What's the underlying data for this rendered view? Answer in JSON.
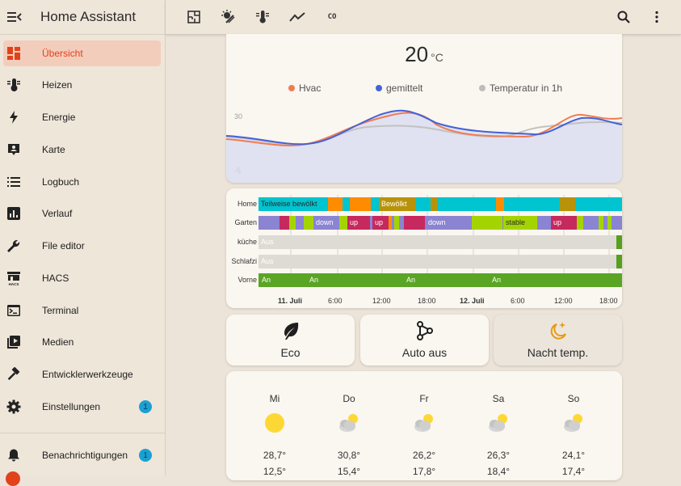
{
  "app": {
    "title": "Home Assistant"
  },
  "sidebar": {
    "items": [
      {
        "label": "Übersicht",
        "icon": "dashboard-icon",
        "active": true
      },
      {
        "label": "Heizen",
        "icon": "thermometer-icon"
      },
      {
        "label": "Energie",
        "icon": "lightning-icon"
      },
      {
        "label": "Karte",
        "icon": "map-account-icon"
      },
      {
        "label": "Logbuch",
        "icon": "list-icon"
      },
      {
        "label": "Verlauf",
        "icon": "chart-box-icon"
      },
      {
        "label": "File editor",
        "icon": "wrench-icon"
      },
      {
        "label": "HACS",
        "icon": "hacs-store-icon"
      },
      {
        "label": "Terminal",
        "icon": "console-icon"
      },
      {
        "label": "Medien",
        "icon": "play-box-icon"
      },
      {
        "label": "Entwicklerwerkzeuge",
        "icon": "hammer-icon"
      },
      {
        "label": "Einstellungen",
        "icon": "gear-icon",
        "badge": "1"
      }
    ],
    "notifications": {
      "label": "Benachrichtigungen",
      "icon": "bell-icon",
      "badge": "1"
    }
  },
  "topbar": {
    "tabs": [
      {
        "icon": "floorplan-icon"
      },
      {
        "icon": "weather-partly-icon"
      },
      {
        "icon": "thermometer-lines-icon"
      },
      {
        "icon": "trend-line-icon"
      },
      {
        "label": "CO"
      }
    ],
    "actions": [
      {
        "icon": "search-icon"
      },
      {
        "icon": "more-vertical-icon"
      }
    ]
  },
  "temperature_card": {
    "value": "20",
    "unit": "°C",
    "y_labels": [
      "30",
      "-5"
    ],
    "legend": [
      {
        "name": "Hvac",
        "color": "#f07c52"
      },
      {
        "name": "gemittelt",
        "color": "#4462d8"
      },
      {
        "name": "Temperatur in 1h",
        "color": "#bdbdbd"
      }
    ]
  },
  "timeline_card": {
    "rows": [
      {
        "label": "Home",
        "texts": [
          "Teilweise bewölkt",
          "Bewölkt"
        ]
      },
      {
        "label": "Garten",
        "texts": [
          "down",
          "up",
          "up",
          "down",
          "stable",
          "up"
        ]
      },
      {
        "label": "küche",
        "texts": [
          "Aus"
        ]
      },
      {
        "label": "Schlafzi",
        "texts": [
          "Aus"
        ]
      },
      {
        "label": "Vorne",
        "texts": [
          "An",
          "An",
          "An",
          "An"
        ]
      }
    ],
    "axis": [
      "11. Juli",
      "6:00",
      "12:00",
      "18:00",
      "12. Juli",
      "6:00",
      "12:00",
      "18:00"
    ]
  },
  "buttons": [
    {
      "label": "Eco",
      "icon": "leaf-icon"
    },
    {
      "label": "Auto aus",
      "icon": "source-branch-icon"
    },
    {
      "label": "Nacht temp.",
      "icon": "moon-star-icon"
    }
  ],
  "weather": {
    "days": [
      {
        "day": "Mi",
        "high": "28,7°",
        "low": "12,5°",
        "icon": "sunny-icon"
      },
      {
        "day": "Do",
        "high": "30,8°",
        "low": "15,4°",
        "icon": "partly-cloudy-icon"
      },
      {
        "day": "Fr",
        "high": "26,2°",
        "low": "17,8°",
        "icon": "partly-cloudy-icon"
      },
      {
        "day": "Sa",
        "high": "26,3°",
        "low": "18,4°",
        "icon": "partly-cloudy-icon"
      },
      {
        "day": "So",
        "high": "24,1°",
        "low": "17,4°",
        "icon": "partly-cloudy-icon"
      }
    ]
  }
}
